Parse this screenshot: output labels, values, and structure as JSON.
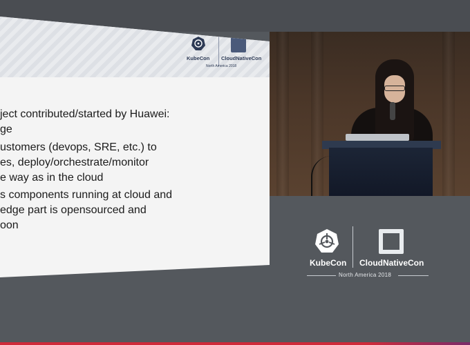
{
  "slide": {
    "logos": {
      "kubecon": "KubeCon",
      "cloudnativecon": "CloudNativeCon",
      "event": "North America 2018"
    },
    "bullets": [
      "ject contributed/started by Huawei:",
      "ge",
      "ustomers (devops, SRE, etc.) to",
      "es, deploy/orchestrate/monitor",
      "e way as in the cloud",
      "s components running at cloud and",
      " edge part is opensourced and",
      "oon"
    ]
  },
  "panel": {
    "kubecon": "KubeCon",
    "cloudnativecon": "CloudNativeCon",
    "event": "North America 2018"
  },
  "icons": {
    "kube": "kubernetes-wheel-icon",
    "cncf": "cncf-logo-icon"
  },
  "colors": {
    "background": "#54585d",
    "accent_bar": "#cf2a3a"
  }
}
